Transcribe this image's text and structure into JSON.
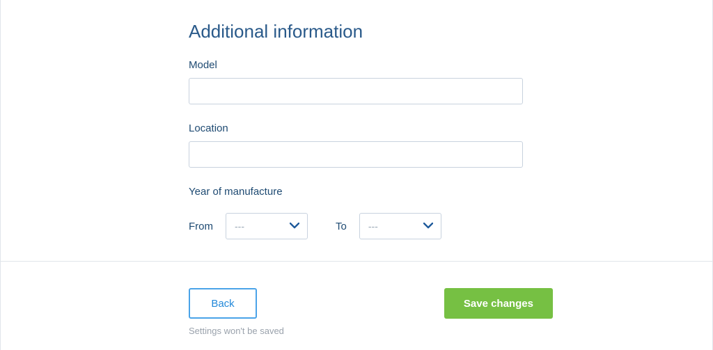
{
  "section": {
    "heading": "Additional information"
  },
  "fields": {
    "model": {
      "label": "Model",
      "value": ""
    },
    "location": {
      "label": "Location",
      "value": ""
    },
    "yearOfManufacture": {
      "label": "Year of manufacture",
      "from": {
        "label": "From",
        "value": "---"
      },
      "to": {
        "label": "To",
        "value": "---"
      }
    }
  },
  "footer": {
    "back": {
      "label": "Back",
      "helper": "Settings won't be saved"
    },
    "save": {
      "label": "Save changes"
    }
  },
  "colors": {
    "headingBlue": "#2a5a8a",
    "labelBlue": "#1e4a72",
    "chevronBlue": "#1e5a9b",
    "saveGreen": "#76c043",
    "backBorder": "#4aa3e8"
  }
}
